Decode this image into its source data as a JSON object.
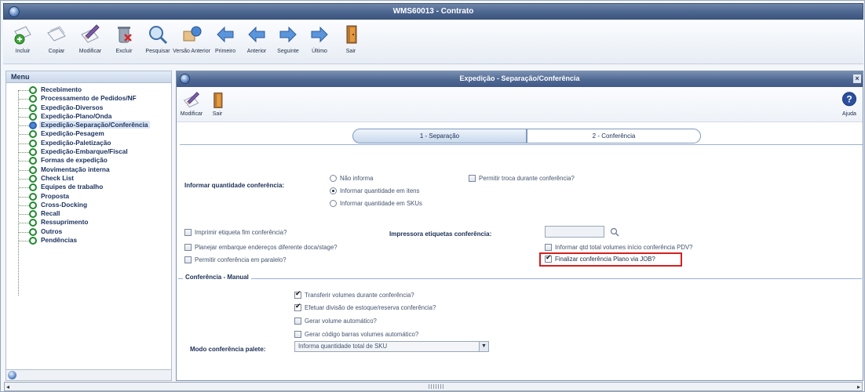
{
  "window": {
    "title": "WMS60013 - Contrato"
  },
  "toolbar": {
    "items": [
      {
        "label": "Incluir",
        "icon": "add-document-icon"
      },
      {
        "label": "Copiar",
        "icon": "copy-icon"
      },
      {
        "label": "Modificar",
        "icon": "edit-pencil-icon"
      },
      {
        "label": "Excluir",
        "icon": "trash-icon"
      },
      {
        "label": "Pesquisar",
        "icon": "search-icon"
      },
      {
        "label": "Versão Anterior",
        "icon": "version-icon"
      },
      {
        "label": "Primeiro",
        "icon": "first-arrow-icon"
      },
      {
        "label": "Anterior",
        "icon": "previous-arrow-icon"
      },
      {
        "label": "Seguinte",
        "icon": "next-arrow-icon"
      },
      {
        "label": "Último",
        "icon": "last-arrow-icon"
      },
      {
        "label": "Sair",
        "icon": "exit-door-icon"
      }
    ]
  },
  "menu": {
    "title": "Menu",
    "items": [
      "Recebimento",
      "Processamento de Pedidos/NF",
      "Expedição-Diversos",
      "Expedição-Plano/Onda",
      "Expedição-Separação/Conferência",
      "Expedição-Pesagem",
      "Expedição-Paletização",
      "Expedição-Embarque/Fiscal",
      "Formas de expedição",
      "Movimentação interna",
      "Check List",
      "Equipes de trabalho",
      "Proposta",
      "Cross-Docking",
      "Recall",
      "Ressuprimento",
      "Outros",
      "Pendências"
    ],
    "selected_index": 4
  },
  "inner": {
    "title": "Expedição - Separação/Conferência",
    "toolbar": {
      "modificar": "Modificar",
      "sair": "Sair",
      "ajuda": "Ajuda"
    },
    "tabs": [
      {
        "label": "1 - Separação",
        "active": false
      },
      {
        "label": "2 - Conferência",
        "active": true
      }
    ],
    "informar_label": "Informar quantidade conferência:",
    "radio_options": [
      {
        "label": "Não informa",
        "selected": false
      },
      {
        "label": "Informar quantidade em itens",
        "selected": true
      },
      {
        "label": "Informar quantidade em SKUs",
        "selected": false
      }
    ],
    "checks_top": {
      "permitir_troca": {
        "label": "Permitir troca durante conferência?",
        "checked": false
      },
      "imprimir_etiqueta": {
        "label": "Imprimir etiqueta fim conferência?",
        "checked": false
      },
      "planejar_embarque": {
        "label": "Planejar embarque endereços diferente doca/stage?",
        "checked": false
      },
      "permitir_paralelo": {
        "label": "Permitir conferência em paralelo?",
        "checked": false
      },
      "informar_qtd_total": {
        "label": "Informar qtd total volumes início conferência PDV?",
        "checked": false
      },
      "finalizar_job": {
        "label": "Finalizar conferência Plano via JOB?",
        "checked": true
      }
    },
    "impressora_label": "Impressora etiquetas conferência:",
    "impressora_value": "",
    "manual": {
      "title": "Conferência - Manual",
      "checks": [
        {
          "label": "Transferir volumes durante conferência?",
          "checked": true
        },
        {
          "label": "Efetuar divisão de estoque/reserva conferência?",
          "checked": true
        },
        {
          "label": "Gerar volume automático?",
          "checked": false
        },
        {
          "label": "Gerar código barras volumes automático?",
          "checked": false
        }
      ],
      "modo_label": "Modo conferência palete:",
      "modo_value": "Informa quantidade total de SKU"
    }
  }
}
